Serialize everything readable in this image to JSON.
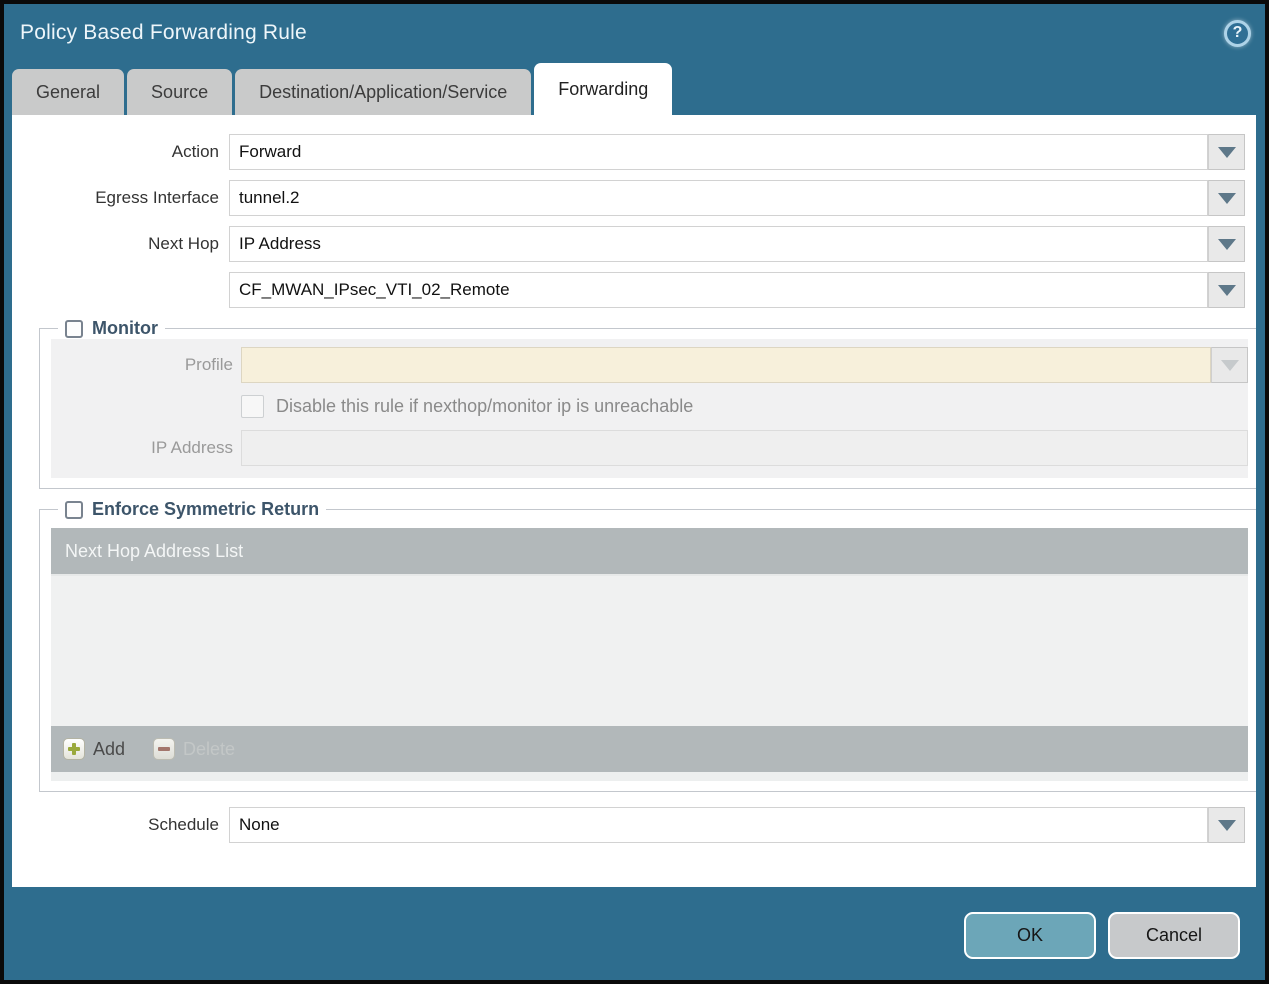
{
  "window": {
    "title": "Policy Based Forwarding Rule"
  },
  "help": {
    "glyph": "?"
  },
  "tabs": [
    {
      "label": "General",
      "active": false
    },
    {
      "label": "Source",
      "active": false
    },
    {
      "label": "Destination/Application/Service",
      "active": false
    },
    {
      "label": "Forwarding",
      "active": true
    }
  ],
  "form": {
    "action": {
      "label": "Action",
      "value": "Forward"
    },
    "egress_interface": {
      "label": "Egress Interface",
      "value": "tunnel.2"
    },
    "next_hop": {
      "label": "Next Hop",
      "value": "IP Address"
    },
    "next_hop_value": {
      "value": "CF_MWAN_IPsec_VTI_02_Remote"
    },
    "monitor": {
      "legend": "Monitor",
      "checked": false,
      "profile": {
        "label": "Profile",
        "value": ""
      },
      "disable_rule": {
        "label": "Disable this rule if nexthop/monitor ip is unreachable",
        "checked": false
      },
      "ip_address": {
        "label": "IP Address",
        "value": ""
      }
    },
    "enforce": {
      "legend": "Enforce Symmetric Return",
      "checked": false,
      "table": {
        "header": "Next Hop Address List",
        "rows": []
      },
      "toolbar": {
        "add_label": "Add",
        "delete_label": "Delete"
      }
    },
    "schedule": {
      "label": "Schedule",
      "value": "None"
    }
  },
  "footer": {
    "ok_label": "OK",
    "cancel_label": "Cancel"
  },
  "colors": {
    "header_teal": "#2e6d8e",
    "ok_button": "#6ca6b8",
    "disabled_beige": "#f7f0db",
    "table_header_grey": "#b2b8ba",
    "legend_text": "#3d556a"
  }
}
